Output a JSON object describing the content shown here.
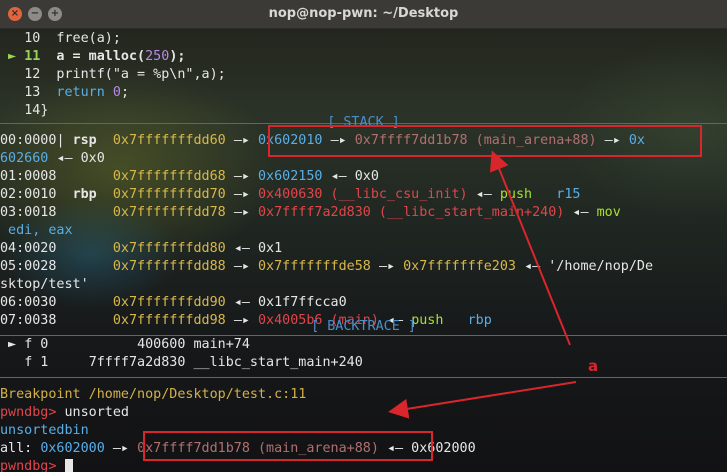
{
  "window": {
    "title": "nop@nop-pwn: ~/Desktop"
  },
  "titlebar": {
    "close": "×",
    "minimize": "−",
    "maximize": "+"
  },
  "source": [
    {
      "num": "10",
      "code": "  free(a);"
    },
    {
      "num": "11",
      "code_a": "  a = malloc(",
      "code_n": "250",
      "code_b": ");"
    },
    {
      "num": "12",
      "code": "  printf(\"a = %p\\n\",a);"
    },
    {
      "num": "13",
      "code_kw": "  return ",
      "code_n": "0",
      "code_end": ";"
    },
    {
      "num": "14",
      "code": "}"
    }
  ],
  "section": {
    "stack": "[ STACK ]",
    "backtrace": "[ BACKTRACE ]"
  },
  "stack": {
    "r0": {
      "off": "00:0000",
      "reg": "rsp",
      "addr": "0x7fffffffdd60",
      "v1": "0x602010",
      "v2": "0x7ffff7dd1b78 (main_arena+88)",
      "v3": "0x"
    },
    "r0b": {
      "v": "602660",
      "v2": "0x0"
    },
    "r1": {
      "off": "01:0008",
      "addr": "0x7fffffffdd68",
      "v1": "0x602150",
      "v2": "0x0"
    },
    "r2": {
      "off": "02:0010",
      "reg": "rbp",
      "addr": "0x7fffffffdd70",
      "v1": "0x400630 (__libc_csu_init)",
      "ins": "push",
      "op": "r15"
    },
    "r3": {
      "off": "03:0018",
      "addr": "0x7fffffffdd78",
      "v1": "0x7ffff7a2d830 (__libc_start_main+240)",
      "ins": "mov"
    },
    "r3b": {
      "v": " edi, eax"
    },
    "r4": {
      "off": "04:0020",
      "addr": "0x7fffffffdd80",
      "v1": "0x1"
    },
    "r5": {
      "off": "05:0028",
      "addr": "0x7fffffffdd88",
      "v1": "0x7fffffffde58",
      "v2": "0x7fffffffe203",
      "v3": "'/home/nop/De"
    },
    "r5b": {
      "v": "sktop/test'"
    },
    "r6": {
      "off": "06:0030",
      "addr": "0x7fffffffdd90",
      "v1": "0x1f7ffcca0"
    },
    "r7": {
      "off": "07:0038",
      "addr": "0x7fffffffdd98",
      "v1": "0x4005b6 (main)",
      "ins": "push",
      "op": "rbp"
    }
  },
  "backtrace": [
    {
      "frame": "f 0",
      "addr": "400600",
      "sym": "main+74"
    },
    {
      "frame": "f 1",
      "addr": "7ffff7a2d830",
      "sym": "__libc_start_main+240"
    }
  ],
  "console": {
    "breakpoint": "Breakpoint /home/nop/Desktop/test.c:11",
    "prompt": "pwndbg>",
    "cmd1": "unsorted",
    "bin": "unsortedbin",
    "all_label": "all:",
    "all_v1": "0x602000",
    "all_v2": "0x7ffff7dd1b78 (main_arena+88)",
    "all_v3": "0x602000"
  },
  "arrows": {
    "right": "—▸",
    "left": "◂—"
  },
  "annotation": {
    "label": "a",
    "color": "#d8262c"
  }
}
